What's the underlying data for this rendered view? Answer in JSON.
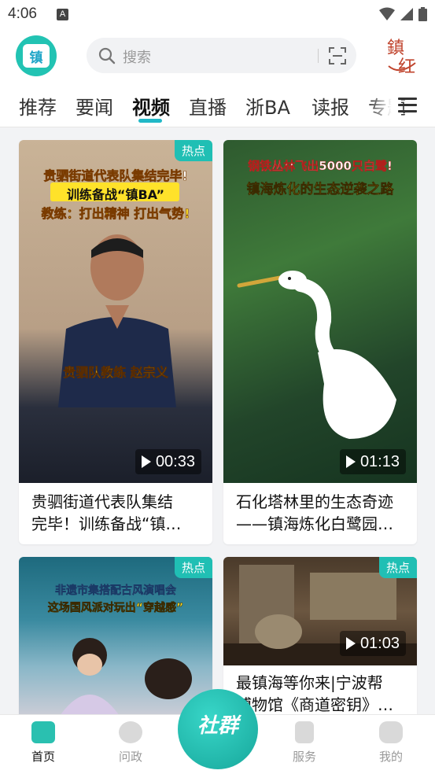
{
  "status": {
    "time": "4:06",
    "sim": "A"
  },
  "search": {
    "placeholder": "搜索"
  },
  "brand": {
    "logo_text": "镇",
    "right_logo": "鎮红"
  },
  "tabs": [
    {
      "label": "推荐"
    },
    {
      "label": "要闻"
    },
    {
      "label": "视频",
      "active": true
    },
    {
      "label": "直播"
    },
    {
      "label": "浙BA"
    },
    {
      "label": "读报"
    },
    {
      "label": "专题"
    }
  ],
  "cards": [
    {
      "badge": "热点",
      "duration": "00:33",
      "thumb_lines": [
        "贵驷街道代表队集结完毕!",
        "训练备战“镇BA”",
        "教练：打出精神 打出气势!",
        "贵驷队教练 赵宗义"
      ],
      "title_lines": [
        "贵驷街道代表队集结",
        "完毕！训练备战“镇…"
      ]
    },
    {
      "badge": "",
      "duration": "01:13",
      "thumb_lines": [
        "钢铁丛林飞出5000只白鹭!",
        "镇海炼化的生态逆袭之路"
      ],
      "title_lines": [
        "石化塔林里的生态奇迹",
        "——镇海炼化白鹭园…"
      ]
    },
    {
      "badge": "热点",
      "duration": "",
      "thumb_lines": [
        "非遗市集搭配古风演唱会",
        "这场国风派对玩出“穿越感”"
      ],
      "title_lines": []
    },
    {
      "badge": "热点",
      "duration": "01:03",
      "thumb_lines": [],
      "title_lines": [
        "最镇海等你来|宁波帮",
        "博物馆《商道密钥》…"
      ]
    }
  ],
  "bottom_nav": [
    {
      "label": "首页",
      "active": true
    },
    {
      "label": "问政"
    },
    {
      "label": "社群",
      "center": true
    },
    {
      "label": "服务"
    },
    {
      "label": "我的"
    }
  ],
  "colors": {
    "accent": "#21b8c7",
    "badge": "#20bfb4",
    "nav_active": "#2ac0b0"
  }
}
